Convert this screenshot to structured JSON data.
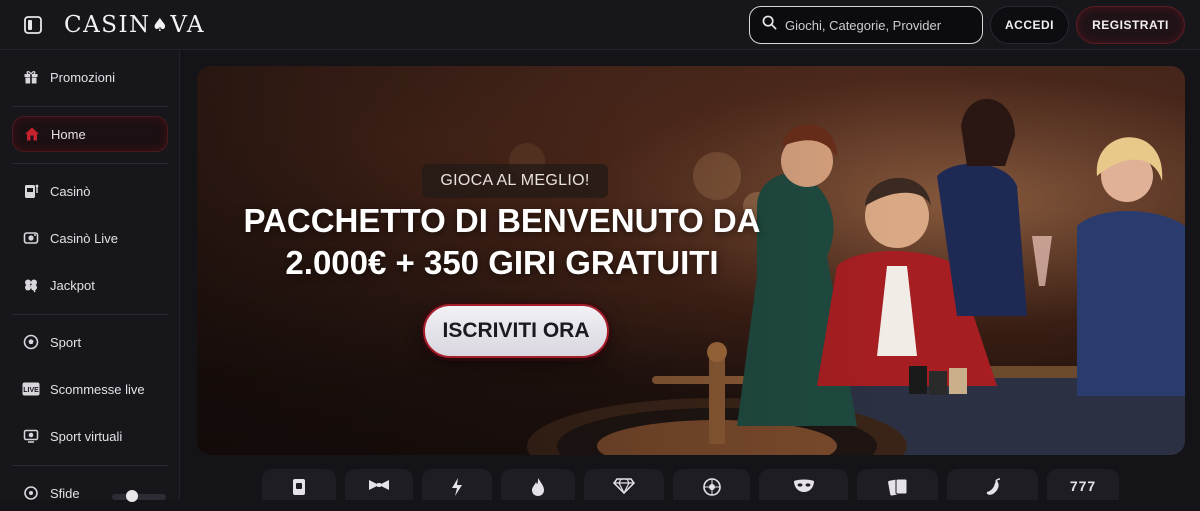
{
  "header": {
    "logo": {
      "pre": "CASIN",
      "mark": "♠",
      "post": "VA"
    },
    "search_placeholder": "Giochi, Categorie, Provider",
    "login_label": "ACCEDI",
    "register_label": "REGISTRATI"
  },
  "sidebar": {
    "items": [
      {
        "label": "Promozioni",
        "icon": "gift-icon"
      },
      {
        "label": "Home",
        "icon": "home-icon",
        "active": true
      },
      {
        "label": "Casinò",
        "icon": "slot-machine-icon"
      },
      {
        "label": "Casinò Live",
        "icon": "live-casino-icon"
      },
      {
        "label": "Jackpot",
        "icon": "clover-icon"
      },
      {
        "label": "Sport",
        "icon": "soccer-ball-icon"
      },
      {
        "label": "Scommesse live",
        "icon": "live-badge-icon"
      },
      {
        "label": "Sport virtuali",
        "icon": "virtual-sport-icon"
      },
      {
        "label": "Sfide",
        "icon": "challenge-icon"
      }
    ]
  },
  "hero": {
    "kicker": "GIOCA AL MEGLIO!",
    "headline_line1": "PACCHETTO DI BENVENUTO DA",
    "headline_line2": "2.000€ + 350 GIRI GRATUITI",
    "cta_label": "ISCRIVITI ORA"
  },
  "categories": {
    "tiles": [
      {
        "icon": "book-icon"
      },
      {
        "icon": "bowtie-icon"
      },
      {
        "icon": "lightning-icon"
      },
      {
        "icon": "flame-icon"
      },
      {
        "icon": "diamond-icon"
      },
      {
        "icon": "roulette-icon"
      },
      {
        "icon": "mask-icon"
      },
      {
        "icon": "cards-icon"
      },
      {
        "icon": "pepper-icon"
      },
      {
        "icon": "sevens-icon",
        "text": "777"
      }
    ]
  },
  "colors": {
    "accent_red": "#c6212f",
    "background": "#141318",
    "panel": "#17161b"
  }
}
